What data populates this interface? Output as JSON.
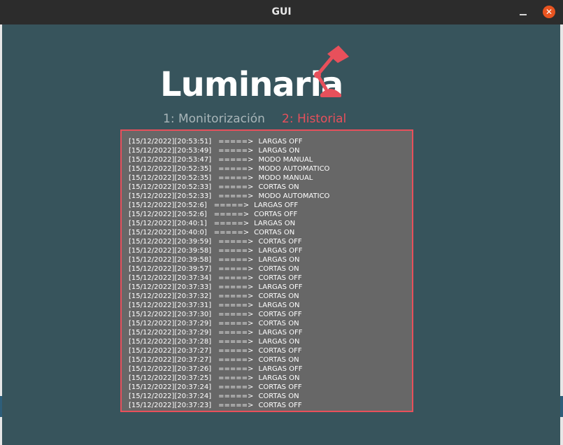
{
  "window": {
    "title": "GUI",
    "close_icon": "✕"
  },
  "logo": {
    "text": "Luminaria",
    "icon": "desk-lamp-icon",
    "accent_color": "#e8505b"
  },
  "tabs": [
    {
      "label": "1: Monitorización",
      "active": false
    },
    {
      "label": "2: Historial",
      "active": true
    }
  ],
  "history": {
    "arrow": "=====>",
    "entries": [
      {
        "stamp": "[15/12/2022][20:53:51]",
        "event": "LARGAS OFF"
      },
      {
        "stamp": "[15/12/2022][20:53:49]",
        "event": "LARGAS ON"
      },
      {
        "stamp": "[15/12/2022][20:53:47]",
        "event": "MODO MANUAL"
      },
      {
        "stamp": "[15/12/2022][20:52:35]",
        "event": "MODO AUTOMATICO"
      },
      {
        "stamp": "[15/12/2022][20:52:35]",
        "event": "MODO MANUAL"
      },
      {
        "stamp": "[15/12/2022][20:52:33]",
        "event": "CORTAS ON"
      },
      {
        "stamp": "[15/12/2022][20:52:33]",
        "event": "MODO AUTOMATICO"
      },
      {
        "stamp": "[15/12/2022][20:52:6]",
        "event": "LARGAS OFF"
      },
      {
        "stamp": "[15/12/2022][20:52:6]",
        "event": "CORTAS OFF"
      },
      {
        "stamp": "[15/12/2022][20:40:1]",
        "event": "LARGAS ON"
      },
      {
        "stamp": "[15/12/2022][20:40:0]",
        "event": "CORTAS ON"
      },
      {
        "stamp": "[15/12/2022][20:39:59]",
        "event": "CORTAS OFF"
      },
      {
        "stamp": "[15/12/2022][20:39:58]",
        "event": "LARGAS OFF"
      },
      {
        "stamp": "[15/12/2022][20:39:58]",
        "event": "LARGAS ON"
      },
      {
        "stamp": "[15/12/2022][20:39:57]",
        "event": "CORTAS ON"
      },
      {
        "stamp": "[15/12/2022][20:37:34]",
        "event": "CORTAS OFF"
      },
      {
        "stamp": "[15/12/2022][20:37:33]",
        "event": "LARGAS OFF"
      },
      {
        "stamp": "[15/12/2022][20:37:32]",
        "event": "CORTAS ON"
      },
      {
        "stamp": "[15/12/2022][20:37:31]",
        "event": "LARGAS ON"
      },
      {
        "stamp": "[15/12/2022][20:37:30]",
        "event": "CORTAS OFF"
      },
      {
        "stamp": "[15/12/2022][20:37:29]",
        "event": "CORTAS ON"
      },
      {
        "stamp": "[15/12/2022][20:37:29]",
        "event": "LARGAS OFF"
      },
      {
        "stamp": "[15/12/2022][20:37:28]",
        "event": "LARGAS ON"
      },
      {
        "stamp": "[15/12/2022][20:37:27]",
        "event": "CORTAS OFF"
      },
      {
        "stamp": "[15/12/2022][20:37:27]",
        "event": "CORTAS ON"
      },
      {
        "stamp": "[15/12/2022][20:37:26]",
        "event": "LARGAS OFF"
      },
      {
        "stamp": "[15/12/2022][20:37:25]",
        "event": "LARGAS ON"
      },
      {
        "stamp": "[15/12/2022][20:37:24]",
        "event": "CORTAS OFF"
      },
      {
        "stamp": "[15/12/2022][20:37:24]",
        "event": "CORTAS ON"
      },
      {
        "stamp": "[15/12/2022][20:37:23]",
        "event": "CORTAS OFF"
      }
    ]
  }
}
